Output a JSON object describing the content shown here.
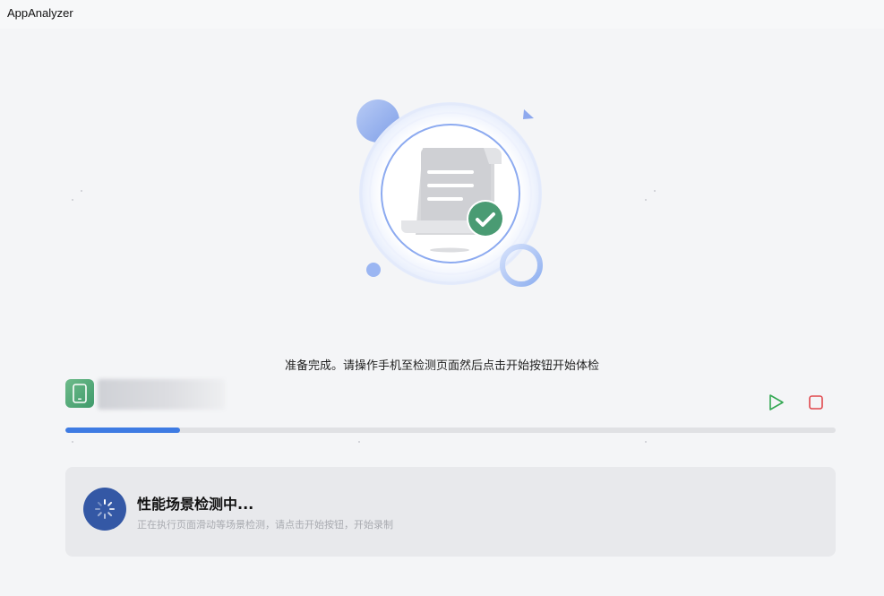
{
  "window": {
    "title": "AppAnalyzer"
  },
  "hero": {
    "illustration_icon": "document-check-icon",
    "accent_color": "#3e7be3",
    "check_color": "#4a9b73"
  },
  "status": {
    "message": "准备完成。请操作手机至检测页面然后点击开始按钮开始体检"
  },
  "device": {
    "icon": "phone-icon"
  },
  "controls": {
    "play_icon": "play-icon",
    "play_color": "#34a853",
    "stop_icon": "stop-icon",
    "stop_color": "#e0474c"
  },
  "progress": {
    "fraction": 0.149,
    "color": "#3e7be3"
  },
  "scene": {
    "title": "性能场景检测中...",
    "subtitle": "正在执行页面滑动等场景检测，请点击开始按钮，开始录制",
    "icon": "loading-spinner-icon"
  }
}
